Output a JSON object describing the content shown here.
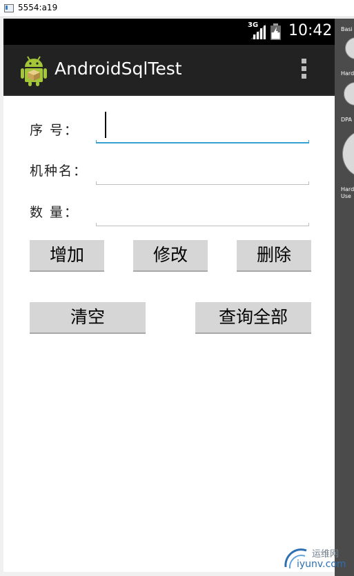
{
  "window": {
    "title": "5554:a19"
  },
  "status_bar": {
    "network": "3G",
    "time": "10:42"
  },
  "action_bar": {
    "title": "AndroidSqlTest"
  },
  "form": {
    "fields": [
      {
        "label": "序 号：",
        "value": ""
      },
      {
        "label": "机种名：",
        "value": ""
      },
      {
        "label": "数 量：",
        "value": ""
      }
    ]
  },
  "buttons": {
    "add": "增加",
    "modify": "修改",
    "delete": "删除",
    "clear": "清空",
    "query_all": "查询全部"
  },
  "side_panel": {
    "labels": [
      "Basi",
      "Hard",
      "DPA",
      "Hard",
      "Use"
    ]
  },
  "watermark": {
    "line1": "运维网",
    "line2": "iyunv.com"
  },
  "colors": {
    "action_bar": "#222222",
    "status_bar": "#000000",
    "focus_accent": "#33a0cf",
    "button": "#d6d6d6",
    "android_green": "#a4c639"
  }
}
